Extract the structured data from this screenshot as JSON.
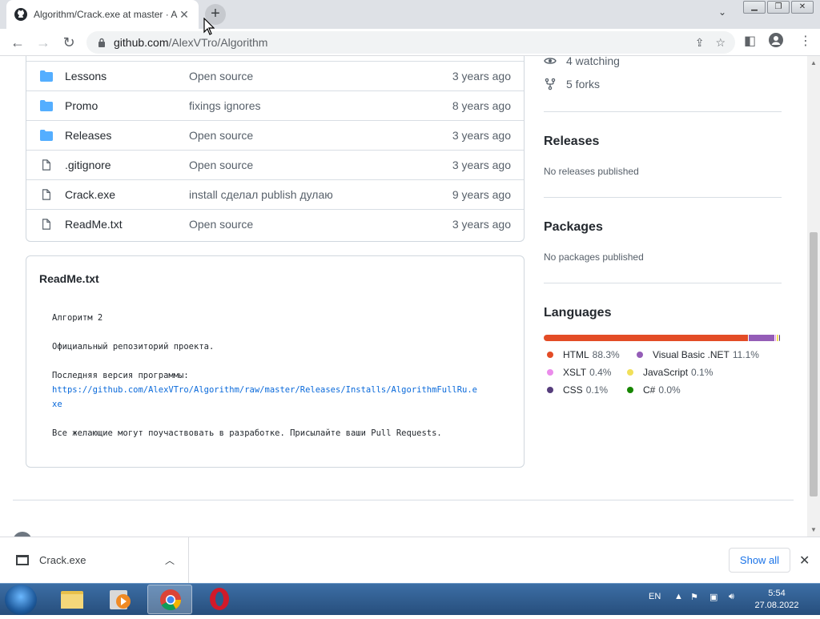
{
  "browser": {
    "tab_title": "Algorithm/Crack.exe at master · A",
    "new_tab_label": "+",
    "url_host": "github.com",
    "url_path": "/AlexVTro/Algorithm"
  },
  "files": [
    {
      "name": "Lessons",
      "type": "folder",
      "message": "Open source",
      "age": "3 years ago"
    },
    {
      "name": "Promo",
      "type": "folder",
      "message": "fixings ignores",
      "age": "8 years ago"
    },
    {
      "name": "Releases",
      "type": "folder",
      "message": "Open source",
      "age": "3 years ago"
    },
    {
      "name": ".gitignore",
      "type": "file",
      "message": "Open source",
      "age": "3 years ago"
    },
    {
      "name": "Crack.exe",
      "type": "file",
      "message": "install сделал publish дулаю",
      "age": "9 years ago"
    },
    {
      "name": "ReadMe.txt",
      "type": "file",
      "message": "Open source",
      "age": "3 years ago"
    }
  ],
  "readme": {
    "title": "ReadMe.txt",
    "line1": "Алгоритм 2",
    "line2": "Официальный репозиторий проекта.",
    "line3": "Последняя версия программы:",
    "link1": "https://github.com/AlexVTro/Algorithm/raw/master/Releases/Installs/AlgorithmFullRu.e",
    "link2": "xe",
    "line4": "Все желающие могут поучаствовать в разработке. Присылайте ваши Pull Requests."
  },
  "sidebar": {
    "watching": "4 watching",
    "forks": "5 forks",
    "releases_title": "Releases",
    "releases_sub": "No releases published",
    "packages_title": "Packages",
    "packages_sub": "No packages published",
    "languages_title": "Languages"
  },
  "languages": [
    {
      "name": "HTML",
      "pct": "88.3%",
      "value": 88.3,
      "color": "#e34c26"
    },
    {
      "name": "Visual Basic .NET",
      "pct": "11.1%",
      "value": 11.1,
      "color": "#945db7"
    },
    {
      "name": "XSLT",
      "pct": "0.4%",
      "value": 0.4,
      "color": "#eb8ceb"
    },
    {
      "name": "JavaScript",
      "pct": "0.1%",
      "value": 0.1,
      "color": "#f1e05a"
    },
    {
      "name": "CSS",
      "pct": "0.1%",
      "value": 0.1,
      "color": "#563d7c"
    },
    {
      "name": "C#",
      "pct": "0.0%",
      "value": 0.0,
      "color": "#178600"
    }
  ],
  "download": {
    "filename": "Crack.exe",
    "show_all": "Show all"
  },
  "taskbar": {
    "lang": "EN",
    "time": "5:54",
    "date": "27.08.2022"
  }
}
